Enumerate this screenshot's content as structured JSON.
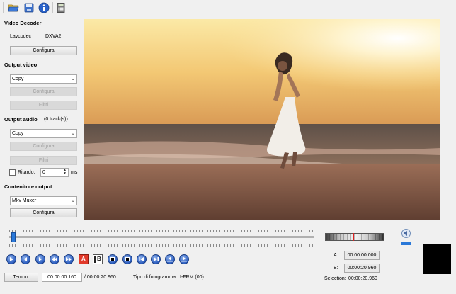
{
  "toolbar": {
    "icons": [
      "open-folder-icon",
      "save-icon",
      "info-icon",
      "calculator-icon"
    ]
  },
  "sidebar": {
    "video_decoder": {
      "title": "Video Decoder",
      "decoder_name": "Lavcodec",
      "decoder_mode": "DXVA2",
      "configure_label": "Configura"
    },
    "output_video": {
      "title": "Output video",
      "codec_value": "Copy",
      "configure_label": "Configura",
      "filters_label": "Filtri"
    },
    "output_audio": {
      "title": "Output audio",
      "tracks": "(0 track(s))",
      "codec_value": "Copy",
      "configure_label": "Configura",
      "filters_label": "Filtri",
      "delay_label": "Ritardo:",
      "delay_value": "0",
      "delay_unit": "ms"
    },
    "container": {
      "title": "Contenitore output",
      "muxer_value": "Mkv Muxer",
      "configure_label": "Configura"
    }
  },
  "player": {
    "time_button_label": "Tempo:",
    "current_time": "00:00:00.160",
    "total_time": "/ 00:00:20.960",
    "frame_type_label": "Tipo di fotogramma:",
    "frame_type_value": "I-FRM (00)",
    "position_fraction": 0.0076,
    "controls": [
      "play",
      "rewind",
      "forward",
      "previous-keyframe",
      "next-keyframe",
      "set-marker-a",
      "set-marker-b",
      "previous-black-frame",
      "next-black-frame",
      "first-frame",
      "last-frame",
      "goto-marker-a",
      "goto-marker-b"
    ]
  },
  "selection": {
    "a_label": "A:",
    "a_value": "00:00:00.000",
    "b_label": "B:",
    "b_value": "00:00:20.960",
    "selection_label": "Selection:",
    "selection_value": "00:00:20.960"
  },
  "colors": {
    "play_button_blue": "#2c5ec0",
    "marker_red": "#e02020"
  }
}
